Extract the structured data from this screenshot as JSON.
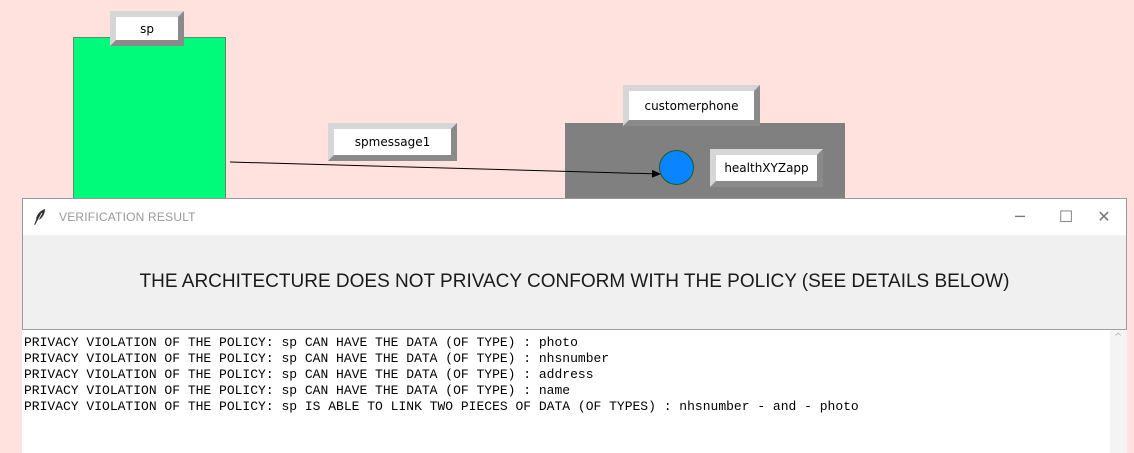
{
  "diagram": {
    "nodes": {
      "sp": {
        "label": "sp"
      },
      "customerphone": {
        "label": "customerphone"
      },
      "app": {
        "label": "healthXYZapp"
      }
    },
    "message": {
      "label": "spmessage1"
    },
    "colors": {
      "background": "#ffe1dd",
      "sp_fill": "#00fa7a",
      "phone_fill": "#808080",
      "app_fill": "#0a84ff"
    }
  },
  "dialog": {
    "title": "VERIFICATION RESULT",
    "heading": "THE ARCHITECTURE DOES NOT PRIVACY CONFORM WITH THE POLICY (SEE DETAILS BELOW)",
    "lines": [
      "PRIVACY VIOLATION OF THE POLICY: sp CAN HAVE THE DATA (OF TYPE) : photo",
      "PRIVACY VIOLATION OF THE POLICY: sp CAN HAVE THE DATA (OF TYPE) : nhsnumber",
      "PRIVACY VIOLATION OF THE POLICY: sp CAN HAVE THE DATA (OF TYPE) : address",
      "PRIVACY VIOLATION OF THE POLICY: sp CAN HAVE THE DATA (OF TYPE) : name",
      "PRIVACY VIOLATION OF THE POLICY: sp IS ABLE TO LINK TWO PIECES OF DATA (OF TYPES) : nhsnumber - and - photo"
    ],
    "icons": [
      "feather-icon",
      "minimize-icon",
      "maximize-icon",
      "close-icon",
      "scroll-up-arrow-icon"
    ]
  }
}
